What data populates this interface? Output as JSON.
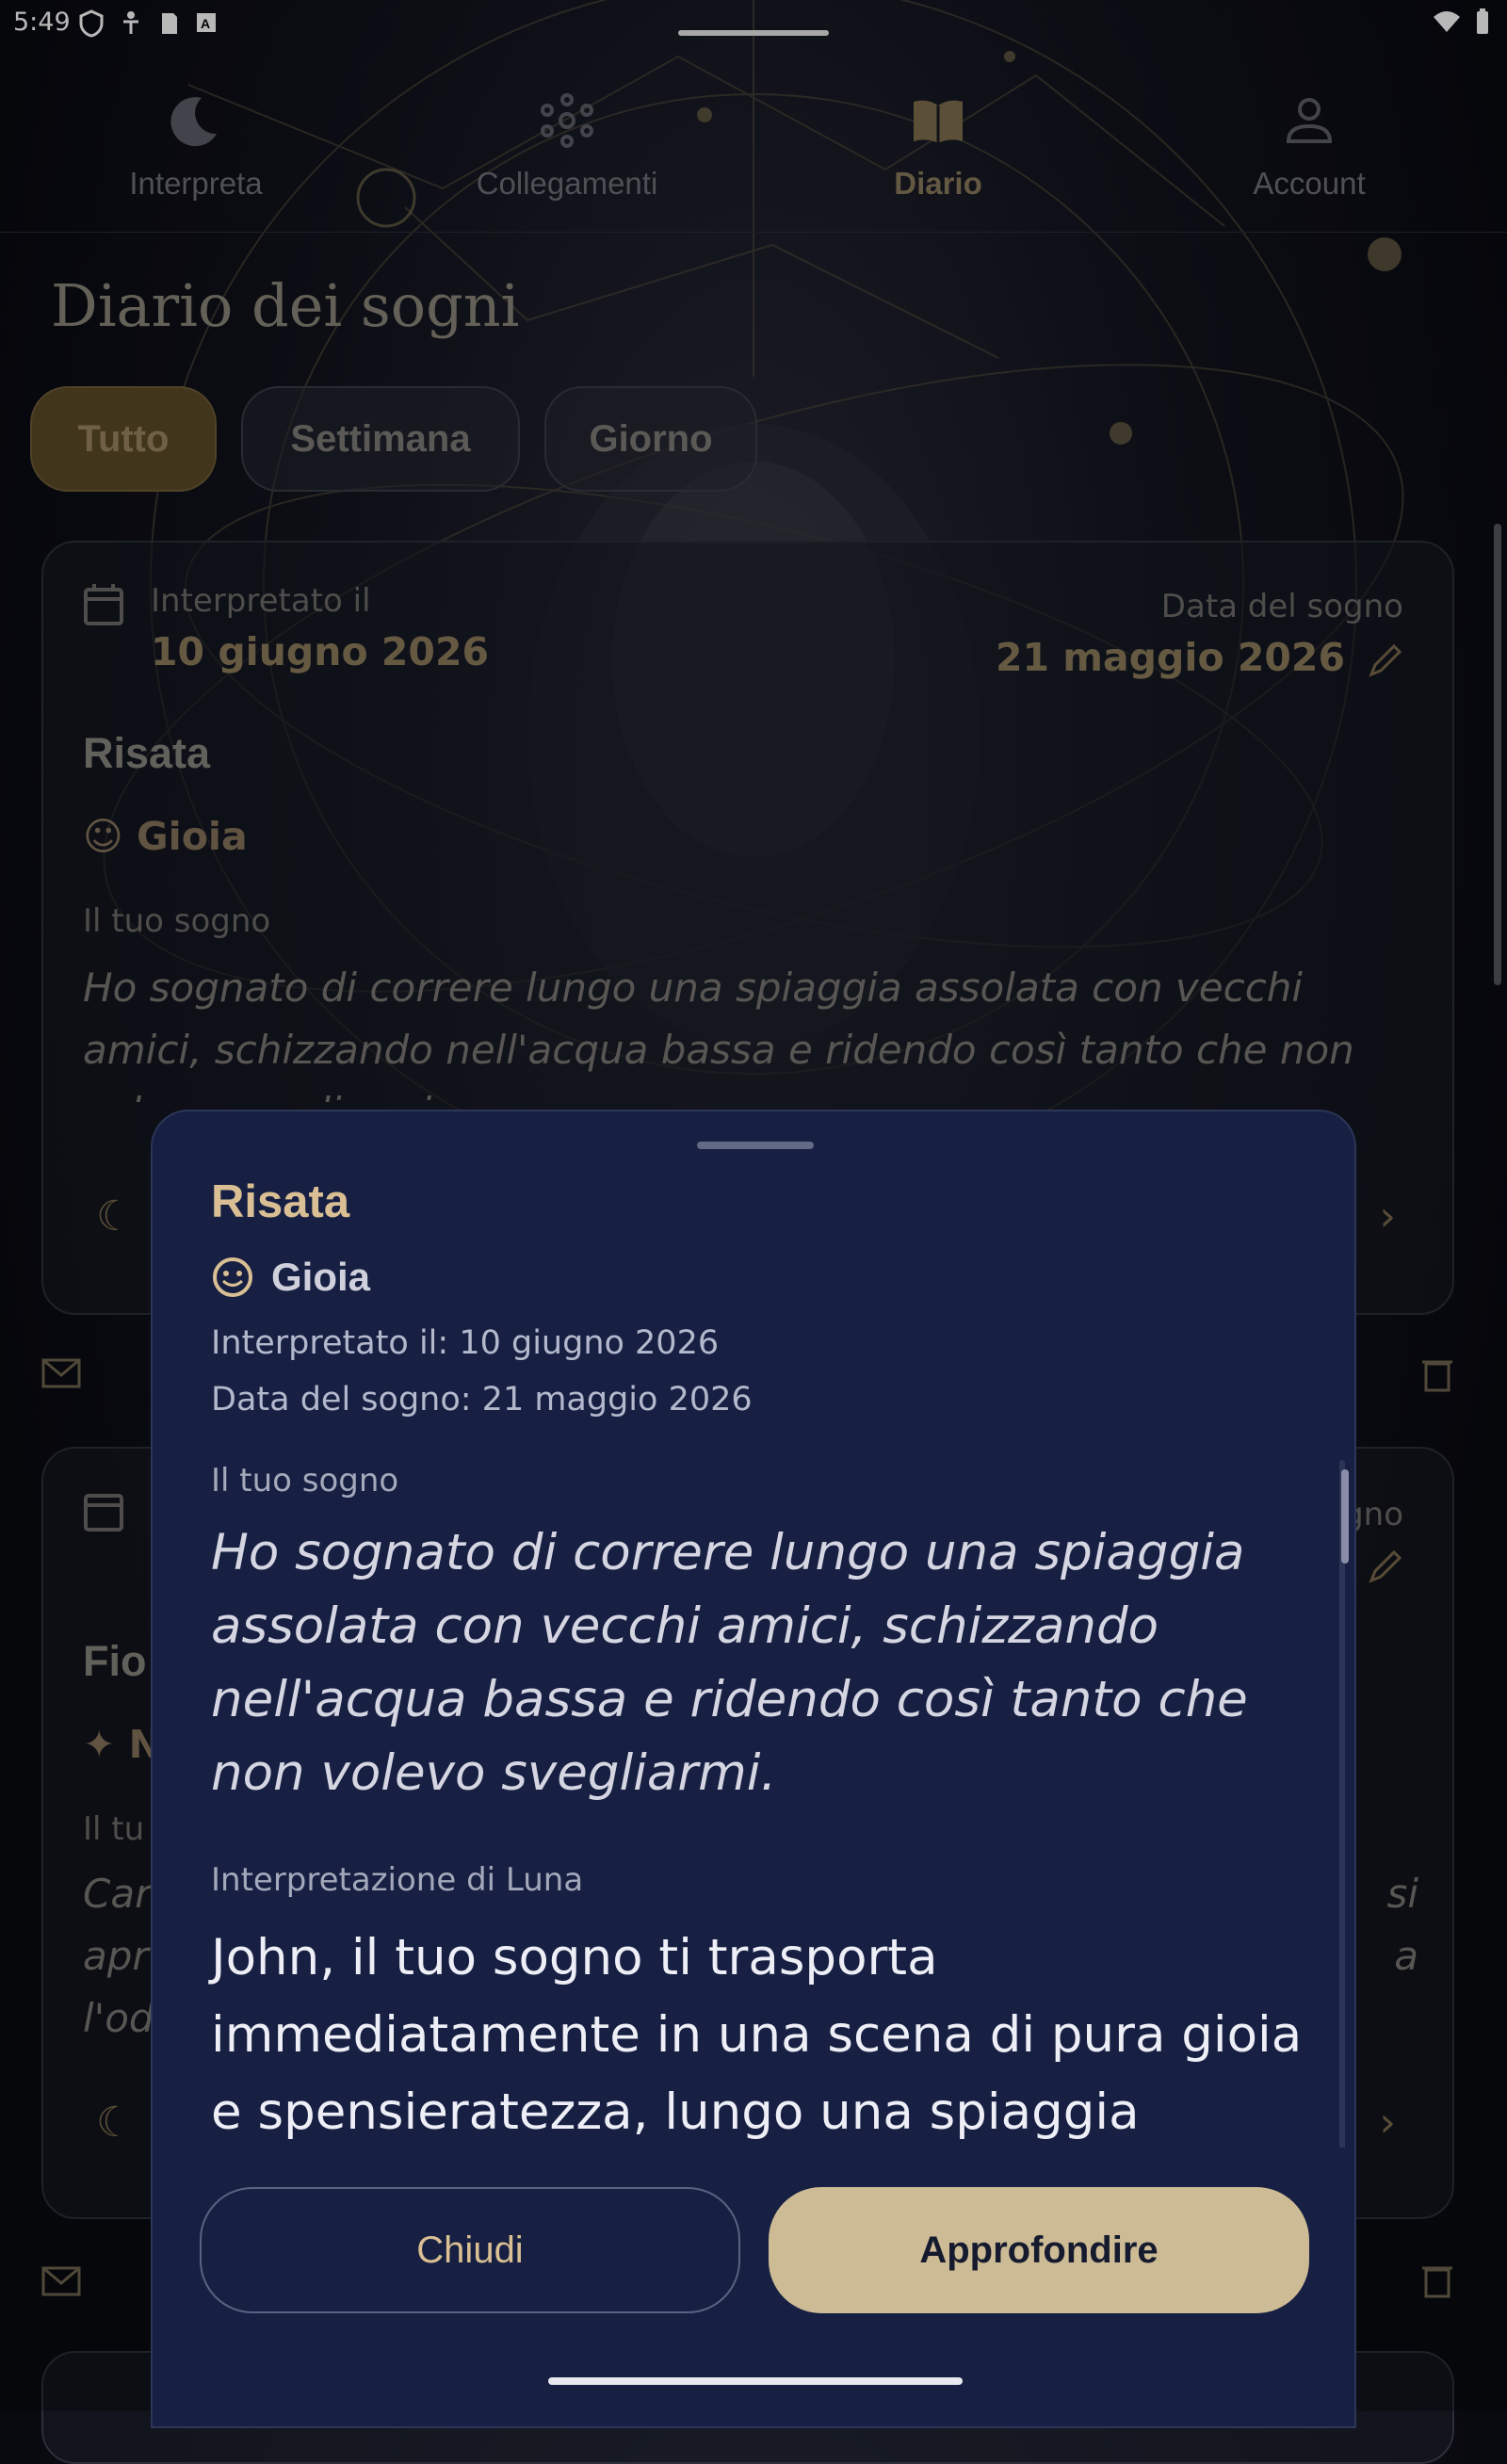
{
  "status_bar": {
    "time": "5:49"
  },
  "tabs": [
    {
      "label": "Interpreta",
      "icon": "moon-icon"
    },
    {
      "label": "Collegamenti",
      "icon": "network-icon"
    },
    {
      "label": "Diario",
      "icon": "book-icon",
      "active": true
    },
    {
      "label": "Account",
      "icon": "person-icon"
    }
  ],
  "page": {
    "title": "Diario dei sogni",
    "filters": [
      "Tutto",
      "Settimana",
      "Giorno"
    ],
    "active_filter": "Tutto"
  },
  "cards": [
    {
      "interpreted_label": "Interpretato il",
      "interpreted_date": "10 giugno 2026",
      "dream_date_label": "Data del sogno",
      "dream_date": "21 maggio 2026",
      "title": "Risata",
      "emotion": "Gioia",
      "dream_label": "Il tuo sogno",
      "dream_text": "Ho sognato di correre lungo una spiaggia assolata con vecchi amici, schizzando nell'acqua bassa e ridendo così tanto che non volevo svegliarmi."
    },
    {
      "title_partial": "Fio",
      "emotion_partial": "N",
      "dream_label_partial": "Il tu",
      "dream_lines_partial": [
        "Car",
        "apr",
        "l'od"
      ],
      "dream_date_label_partial": "gno",
      "right_fragment_1": "si",
      "right_fragment_2": "a"
    }
  ],
  "sheet": {
    "title": "Risata",
    "emotion": "Gioia",
    "interpreted": "Interpretato il: 10 giugno 2026",
    "dream_date": "Data del sogno: 21 maggio 2026",
    "dream_label": "Il tuo sogno",
    "dream_text": "Ho sognato di correre lungo una spiaggia assolata con vecchi amici, schizzando nell'acqua bassa e ridendo così tanto che non volevo svegliarmi.",
    "interp_label": "Interpretazione di Luna",
    "interp_text": "John, il tuo sogno ti trasporta immediatamente in una scena di pura gioia e spensieratezza, lungo una spiaggia baciata dal sole. Indichi di",
    "close_label": "Chiudi",
    "deepen_label": "Approfondire"
  },
  "colors": {
    "accent": "#cdbb95",
    "sheet_bg": "#172043",
    "gold_text": "#d9bf93"
  }
}
